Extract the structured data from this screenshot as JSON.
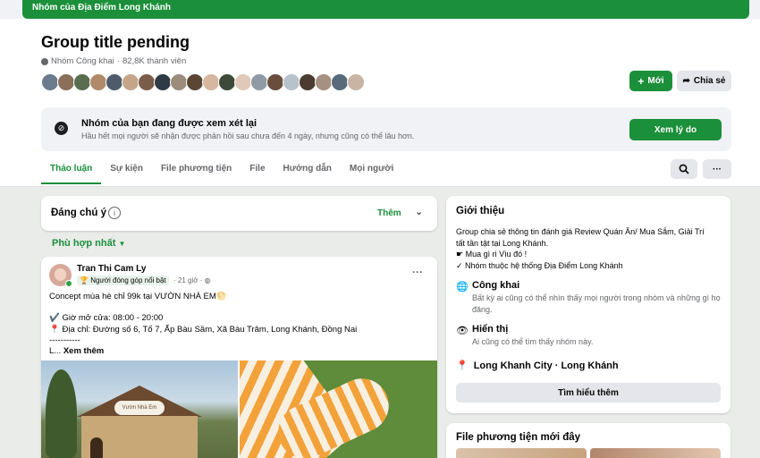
{
  "banner": {
    "text": "Nhóm của Địa Điểm Long Khánh"
  },
  "group": {
    "title": "Group title pending",
    "privacy": "Nhóm Công khai",
    "separator": "·",
    "members": "82,8K thành viên",
    "member_avatar_colors": [
      "#6d7b8f",
      "#8a6f5a",
      "#5a6e4f",
      "#b08a6a",
      "#4f5b6b",
      "#c4a58a",
      "#7a5c4a",
      "#2f3a45",
      "#9c8c7c",
      "#5b4636",
      "#d6b8a0",
      "#3d4a3a",
      "#e0c9b8",
      "#8f9aa5",
      "#6a4e3d",
      "#b7c2cc",
      "#4c3b30",
      "#a69080",
      "#596a7a",
      "#c8b4a4"
    ]
  },
  "actions": {
    "new_label": "Mới",
    "share_label": "Chia sẻ"
  },
  "review": {
    "title": "Nhóm của bạn đang được xem xét lại",
    "subtitle": "Hầu hết mọi người sẽ nhận được phản hồi sau chưa đến 4 ngày, nhưng cũng có thể lâu hơn.",
    "button": "Xem lý do"
  },
  "tabs": [
    {
      "label": "Thảo luận",
      "active": true
    },
    {
      "label": "Sự kiện"
    },
    {
      "label": "File phương tiện"
    },
    {
      "label": "File"
    },
    {
      "label": "Hướng dẫn"
    },
    {
      "label": "Mọi người"
    }
  ],
  "tab_more": "···",
  "notice": {
    "title": "Đáng chú ý",
    "more": "Thêm"
  },
  "sort": {
    "label": "Phù hợp nhất"
  },
  "post": {
    "author": "Tran Thi Cam Ly",
    "badge": "Người đóng góp nổi bật",
    "time": "· 21 giờ ·",
    "more": "···",
    "lines": [
      "Concept mùa hè chỉ 99k tại VƯỜN NHÀ EM🌕",
      "",
      "✔️ Giờ mở cửa: 08:00 - 20:00",
      "📍 Địa chỉ: Đường số 6, Tổ 7, Ấp Bàu Sầm, Xã Bàu Trâm, Long Khánh, Đồng Nai",
      "-----------"
    ],
    "ellipsis": "L... ",
    "see_more": "Xem thêm",
    "photo_sign": "Vườn Nhà Em"
  },
  "intro": {
    "title": "Giới thiệu",
    "desc_lines": [
      "Group chia sẻ thông tin đánh giá Review Quán Ăn/ Mua Sắm, Giải Trí",
      "tất tần tật tại Long Khánh.",
      "☛ Mua gì ri Vìu đó !",
      "✓ Nhóm thuộc hệ thống Địa Điểm Long Khánh"
    ],
    "public_title": "Công khai",
    "public_desc": "Bất kỳ ai cũng có thể nhìn thấy mọi người trong nhóm và những gì họ đăng.",
    "visible_title": "Hiển thị",
    "visible_desc": "Ai cũng có thể tìm thấy nhóm này.",
    "location": "Long Khanh City · Long Khánh",
    "learn_more": "Tìm hiểu thêm"
  },
  "media": {
    "title": "File phương tiện mới đây"
  },
  "colors": {
    "accent": "#1b8f3a",
    "secondary_button": "#e4e6eb",
    "muted_text": "#65676b"
  }
}
